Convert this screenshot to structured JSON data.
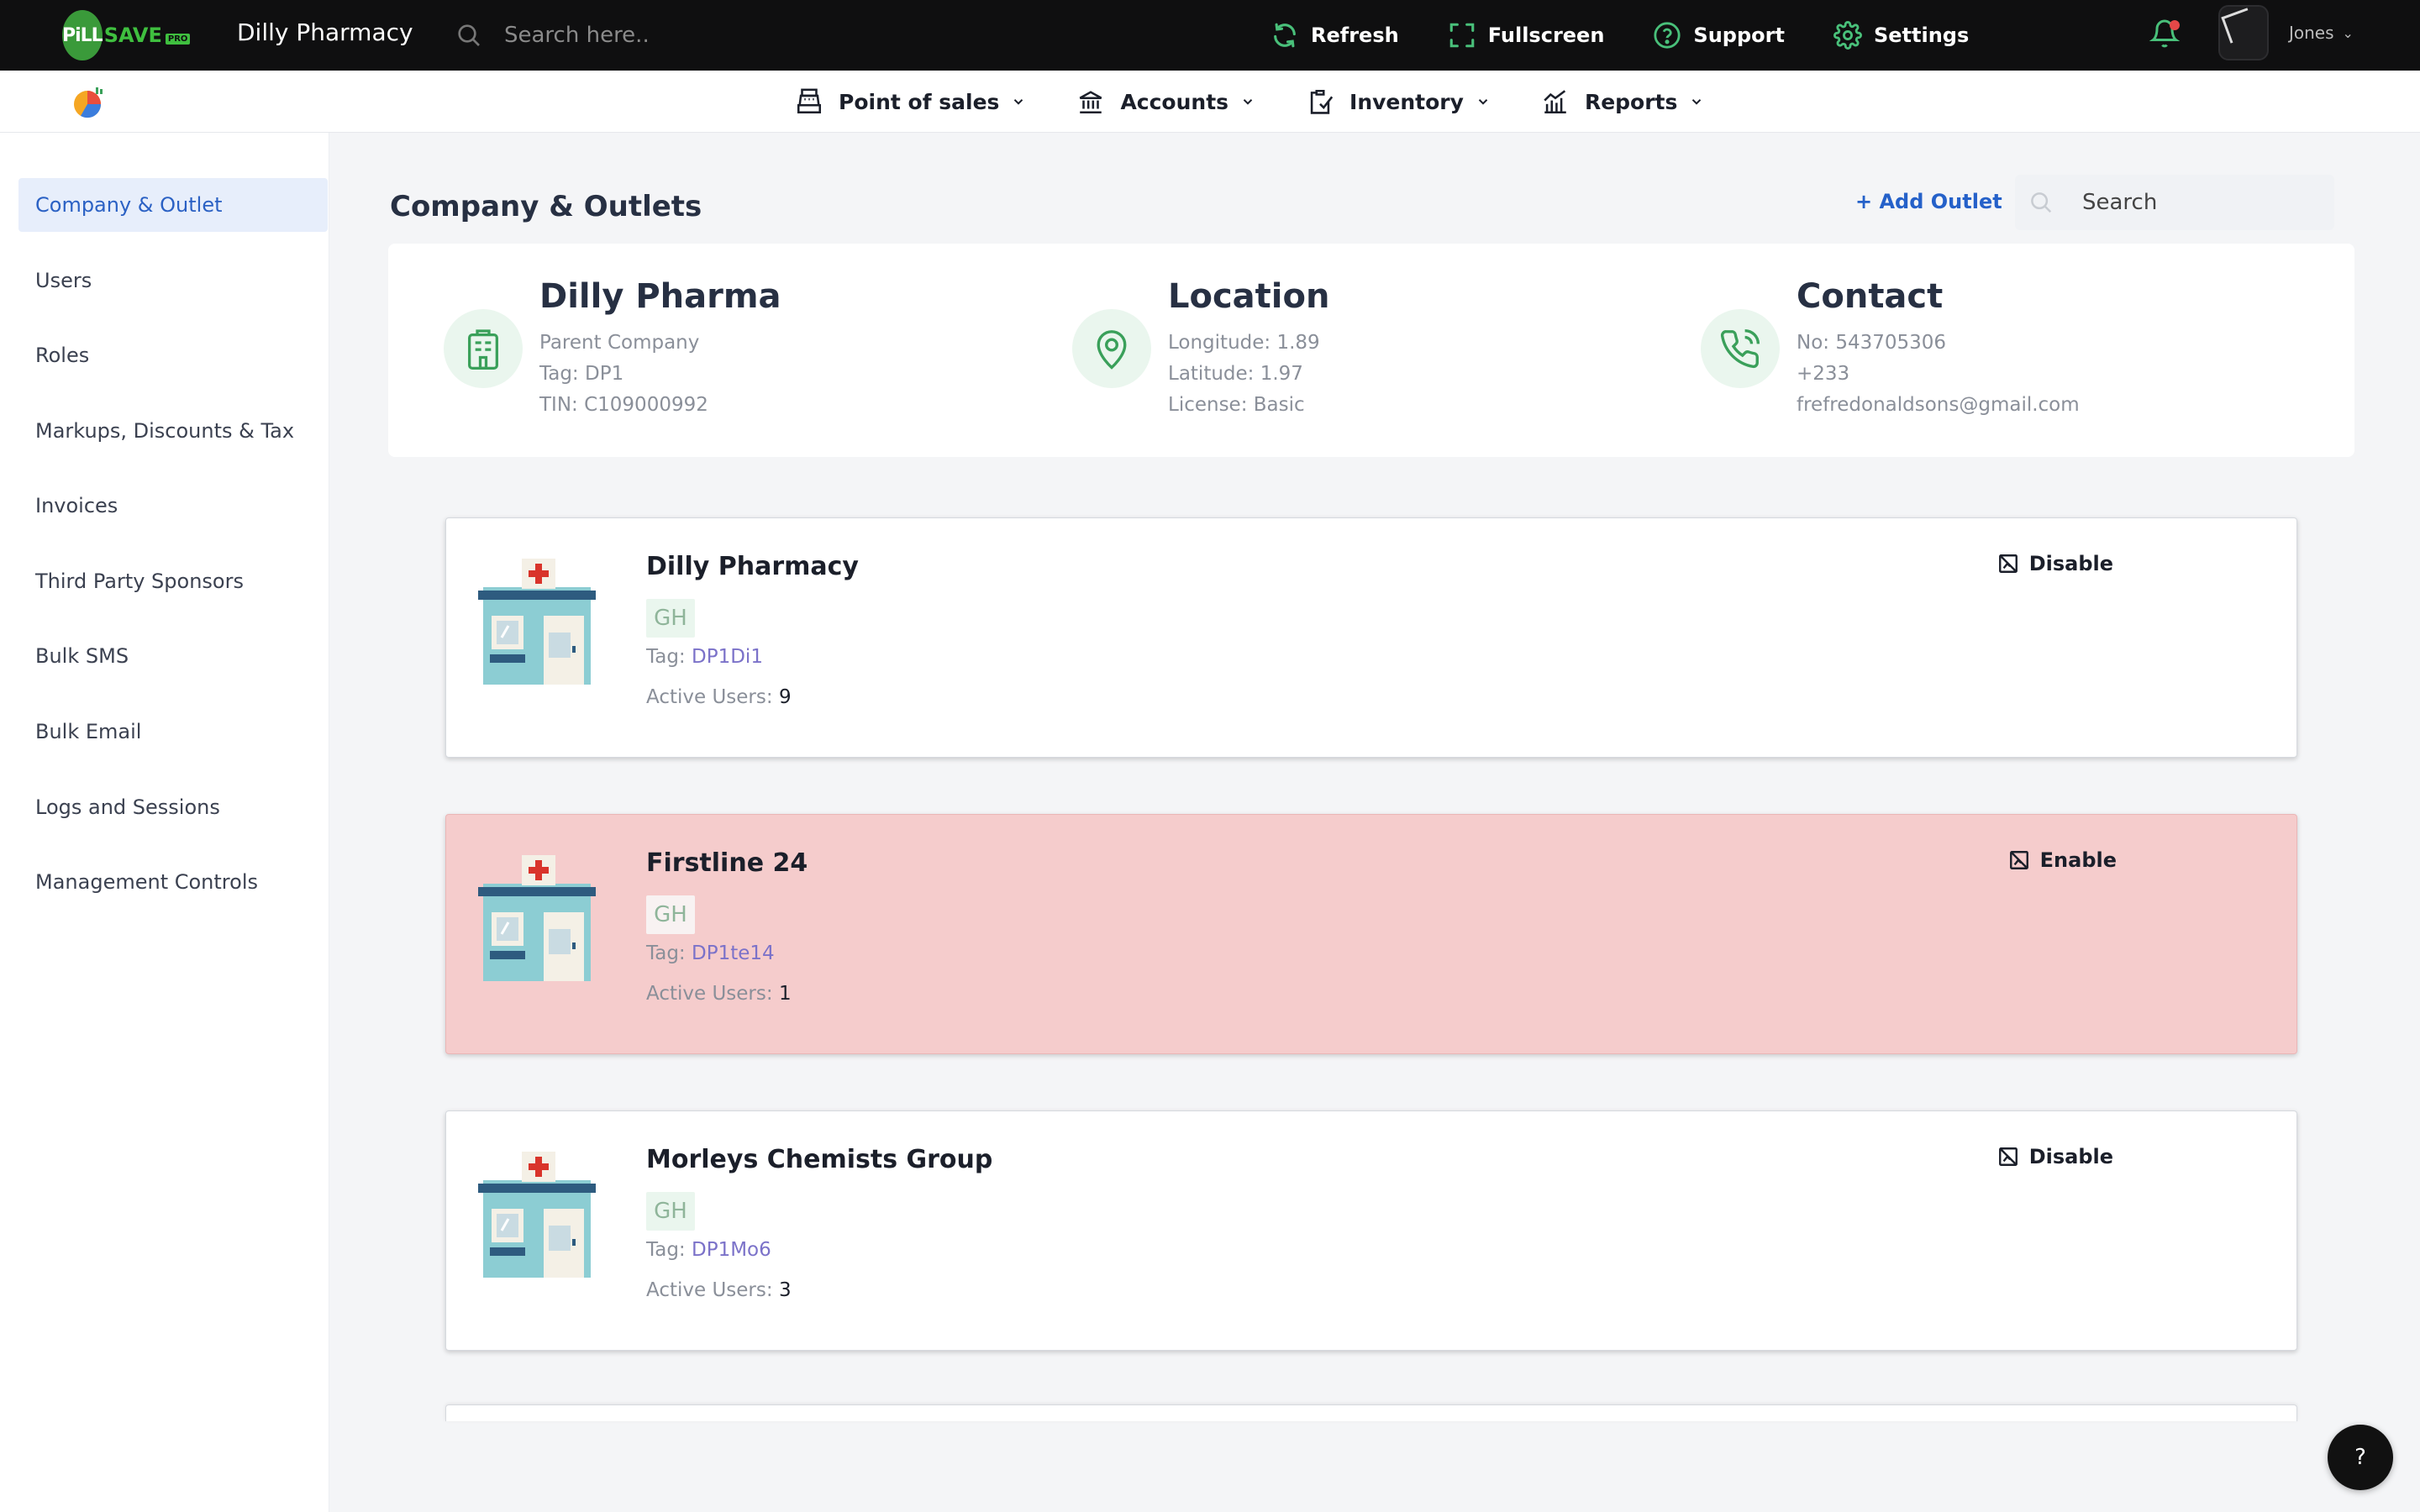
{
  "topbar": {
    "logo_pill": "PiLL",
    "logo_save": "SAVE",
    "logo_pro": "PRO",
    "app_title": "Dilly Pharmacy",
    "search_placeholder": "Search here..",
    "actions": [
      {
        "label": "Refresh",
        "icon": "refresh-icon"
      },
      {
        "label": "Fullscreen",
        "icon": "fullscreen-icon"
      },
      {
        "label": "Support",
        "icon": "help-circle-icon"
      },
      {
        "label": "Settings",
        "icon": "gear-icon"
      }
    ],
    "user_name": "Jones",
    "user_chevron": "⌄"
  },
  "nav": {
    "items": [
      {
        "label": "Point of sales",
        "icon": "cash-register-icon"
      },
      {
        "label": "Accounts",
        "icon": "bank-icon"
      },
      {
        "label": "Inventory",
        "icon": "clipboard-check-icon"
      },
      {
        "label": "Reports",
        "icon": "chart-icon"
      }
    ]
  },
  "sidebar": {
    "items": [
      {
        "label": "Company & Outlet",
        "active": true
      },
      {
        "label": "Users"
      },
      {
        "label": "Roles"
      },
      {
        "label": "Markups, Discounts & Tax"
      },
      {
        "label": "Invoices"
      },
      {
        "label": "Third Party Sponsors"
      },
      {
        "label": "Bulk SMS"
      },
      {
        "label": "Bulk Email"
      },
      {
        "label": "Logs and Sessions"
      },
      {
        "label": "Management Controls"
      }
    ]
  },
  "main": {
    "title": "Company & Outlets",
    "add_outlet": "+ Add Outlet",
    "search_placeholder": "Search",
    "company": {
      "name": "Dilly Pharma",
      "lines": [
        "Parent Company",
        "Tag: DP1",
        "TIN: C109000992"
      ]
    },
    "location": {
      "heading": "Location",
      "lines": [
        "Longitude: 1.89",
        "Latitude: 1.97",
        "License: Basic"
      ]
    },
    "contact": {
      "heading": "Contact",
      "lines": [
        "No: 543705306",
        "+233",
        "frefredonaldsons@gmail.com"
      ]
    },
    "outlets": [
      {
        "name": "Dilly Pharmacy",
        "country": "GH",
        "tag_label": "Tag:",
        "tag": "DP1Di1",
        "users_label": "Active Users:",
        "users": "9",
        "action": "Disable",
        "disabled": false
      },
      {
        "name": "Firstline 24",
        "country": "GH",
        "tag_label": "Tag:",
        "tag": "DP1te14",
        "users_label": "Active Users:",
        "users": "1",
        "action": "Enable",
        "disabled": true
      },
      {
        "name": "Morleys Chemists Group",
        "country": "GH",
        "tag_label": "Tag:",
        "tag": "DP1Mo6",
        "users_label": "Active Users:",
        "users": "3",
        "action": "Disable",
        "disabled": false
      }
    ]
  },
  "help_label": "?",
  "colors": {
    "topbar_bg": "#0f0f10",
    "accent_blue": "#2561c9",
    "active_bg": "#e7eefb",
    "disabled_card": "#f5cccc",
    "icon_green": "#3aa05a",
    "tag_purple": "#7b72c9"
  }
}
